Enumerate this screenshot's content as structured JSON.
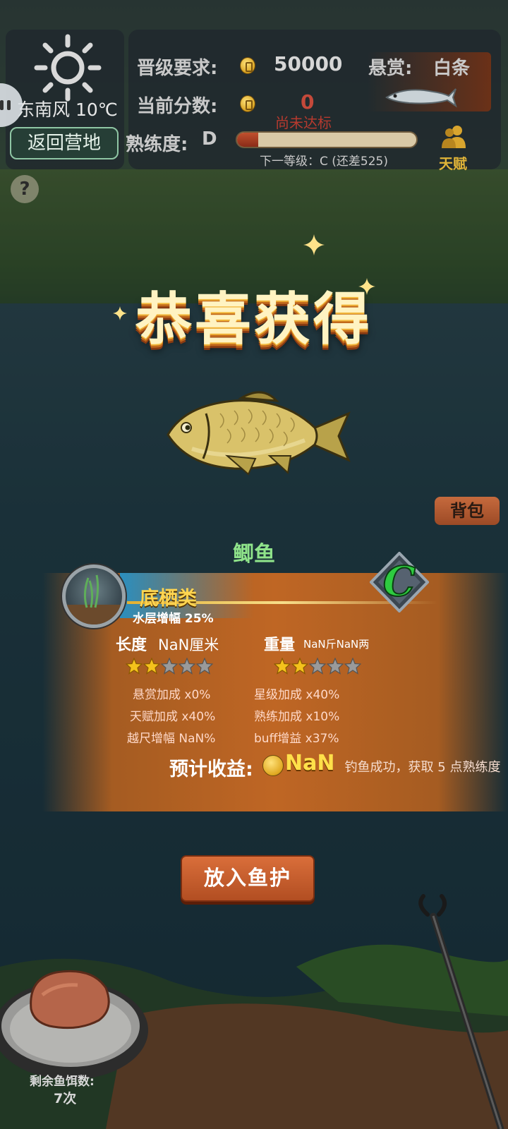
{
  "hud": {
    "wind": "东南风 10℃",
    "return_button": "返回营地",
    "help_label": "?",
    "upgrade_req_label": "晋级要求:",
    "upgrade_req_value": "50000",
    "bounty_label": "悬赏:",
    "bounty_fish": "白条",
    "current_score_label": "当前分数:",
    "current_score_value": "0",
    "not_reached": "尚未达标",
    "proficiency_label": "熟练度:",
    "proficiency_grade": "D",
    "proficiency_progress": 0.12,
    "next_level": "下一等级：C (还差525)",
    "talent_label": "天赋"
  },
  "reward": {
    "title": "恭喜获得",
    "bag_button": "背包",
    "fish_name": "鲫鱼",
    "habitat": "底栖类",
    "habitat_bonus": "水层增幅 25%",
    "grade": "C",
    "length_label": "长度",
    "length_value": "NaN厘米",
    "weight_label": "重量",
    "weight_value": "NaN斤NaN两",
    "length_stars": 2,
    "weight_stars": 2,
    "max_stars": 5,
    "bonuses": {
      "bounty": "悬赏加成 x0%",
      "star": "星级加成 x40%",
      "talent": "天赋加成 x40%",
      "proficiency": "熟练加成 x10%",
      "oversize": "越尺增幅 NaN%",
      "buff": "buff增益 x37%"
    },
    "earnings_label": "预计收益:",
    "earnings_value": "NaN",
    "exp_message": "钓鱼成功，获取 5 点熟练度",
    "put_button": "放入鱼护"
  },
  "bottom": {
    "bait_label": "剩余鱼饵数:",
    "bait_count": "7次"
  },
  "colors": {
    "accent_orange": "#c8692a",
    "gold": "#ffd550",
    "fish_name_green": "#8fe38a",
    "grade_green": "#2ecc40",
    "not_reached_red": "#b63a2e"
  }
}
